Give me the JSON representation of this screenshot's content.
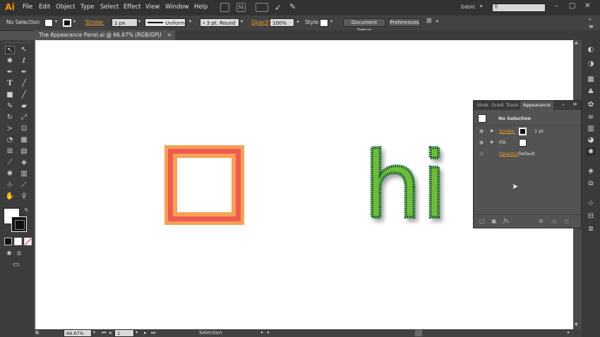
{
  "app": {
    "logo": "Ai"
  },
  "menu": [
    "File",
    "Edit",
    "Object",
    "Type",
    "Select",
    "Effect",
    "View",
    "Window",
    "Help"
  ],
  "menubar": {
    "arrange_number": "51",
    "workspace": "basic",
    "search_placeholder": ""
  },
  "window_controls": [
    "–",
    "□",
    "✕"
  ],
  "control_bar": {
    "selection_state": "No Selection",
    "stroke_label": "Stroke:",
    "stroke_weight": "1 px",
    "profile": "Uniform",
    "brush": "3 pt. Round",
    "opacity_label": "Opacity:",
    "opacity_value": "100%",
    "style_label": "Style:",
    "document_setup": "Document Setup",
    "preferences": "Preferences"
  },
  "document_tab": {
    "title": "The Appearance Panel.ai @ 66.67% (RGB/GPU Preview)",
    "close": "×"
  },
  "status_bar": {
    "zoom": "66.67%",
    "artboard": "1",
    "tool_status": "Selection"
  },
  "canvas": {
    "text_object": "hi",
    "colors": {
      "square_outer": "#f6a157",
      "square_red": "#ee5b4e",
      "text_fill": "#6fbb3d",
      "text_stroke": "#1e6b2c"
    }
  },
  "appearance_panel": {
    "tabs": [
      "Strok",
      "Gradi",
      "Trans",
      "Appearance"
    ],
    "active_tab": "Appearance",
    "header": "No Selection",
    "rows": [
      {
        "label": "Stroke:",
        "value": "1 pt"
      },
      {
        "label": "Fill:",
        "value": ""
      },
      {
        "label": "Opacity:",
        "value": "Default"
      }
    ],
    "footer_fx": "fx."
  },
  "icons": {
    "toolbar": [
      "selection-tool",
      "direct-selection-tool",
      "magic-wand-tool",
      "lasso-tool",
      "pen-tool",
      "curvature-tool",
      "type-tool",
      "line-tool",
      "rectangle-tool",
      "paintbrush-tool",
      "pencil-tool",
      "eraser-tool",
      "rotate-tool",
      "scale-tool",
      "width-tool",
      "free-transform-tool",
      "shape-builder-tool",
      "perspective-grid-tool",
      "mesh-tool",
      "gradient-tool",
      "eyedropper-tool",
      "blend-tool",
      "symbol-sprayer-tool",
      "column-graph-tool",
      "artboard-tool",
      "slice-tool",
      "hand-tool",
      "zoom-tool"
    ]
  }
}
